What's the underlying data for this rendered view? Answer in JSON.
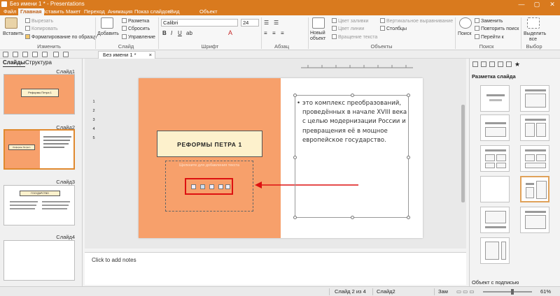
{
  "titlebar": {
    "title": "Без имени 1 * - Presentations",
    "controls": [
      "—",
      "▢",
      "✕"
    ]
  },
  "menu": [
    "Файл",
    "Главная",
    "Вставить",
    "Макет",
    "Переход",
    "Анимация",
    "Показ слайдов",
    "Вид",
    "Объект"
  ],
  "ribbon": {
    "paste": "Вставить",
    "cut": "Вырезать",
    "copy": "Копировать",
    "format_painter": "Форматирование по образцу",
    "add": "Добавить",
    "layout": "Разметка",
    "reset": "Сбросить",
    "manage": "Управление",
    "font_name": "Calibri",
    "font_size": "24",
    "new_object": "Новый объект",
    "fill_color": "Цвет заливки",
    "line_color": "Цвет линии",
    "rotate_text": "Вращение текста",
    "vertical_align": "Вертикальное выравнивание",
    "columns": "Столбцы",
    "search": "Поиск",
    "replace": "Заменить",
    "repeat_search": "Повторить поиск",
    "goto": "Перейти к",
    "select_all_1": "Выделить",
    "select_all_2": "все",
    "groups": {
      "edit": "Изменить",
      "slide": "Слайд",
      "font": "Шрифт",
      "paragraph": "Абзац",
      "objects": "Объекты",
      "search": "Поиск",
      "select": "Выбор"
    }
  },
  "doc_tab": "Без имени 1 *",
  "left_panel": {
    "tab_slides": "Слайды",
    "tab_structure": "Структура",
    "slides": [
      {
        "label": "Слайд1",
        "title": "Реформы Петра 1"
      },
      {
        "label": "Слайд2",
        "title": "Реформы Петра 1"
      },
      {
        "label": "Слайд3",
        "title": "ГОСУДАРСТВО"
      },
      {
        "label": "Слайд4"
      }
    ]
  },
  "slide": {
    "title": "РЕФОРМЫ ПЕТРА 1",
    "subtitle_placeholder": "Щелкните для добавления текста",
    "body_lines": [
      "это комплекс преобразований,",
      "проведённых в начале XVIII века",
      "с целью модернизации России и",
      "превращения её в мощное",
      "европейское государство."
    ]
  },
  "ruler_left": [
    "1",
    "2",
    "3",
    "4",
    "5"
  ],
  "notes_placeholder": "Click to add notes",
  "right_panel": {
    "title": "Разметка слайда",
    "footer": "Объект с подписью",
    "selected_index": 7
  },
  "statusbar": {
    "slide_pos": "Слайд 2 из 4",
    "slide_name": "Слайд2",
    "mode": "Зам",
    "zoom": "61%"
  },
  "colors": {
    "accent": "#d97a1e",
    "slide_panel": "#f7a06b",
    "title_fill": "#fdf1cc",
    "highlight": "#dd1111"
  }
}
